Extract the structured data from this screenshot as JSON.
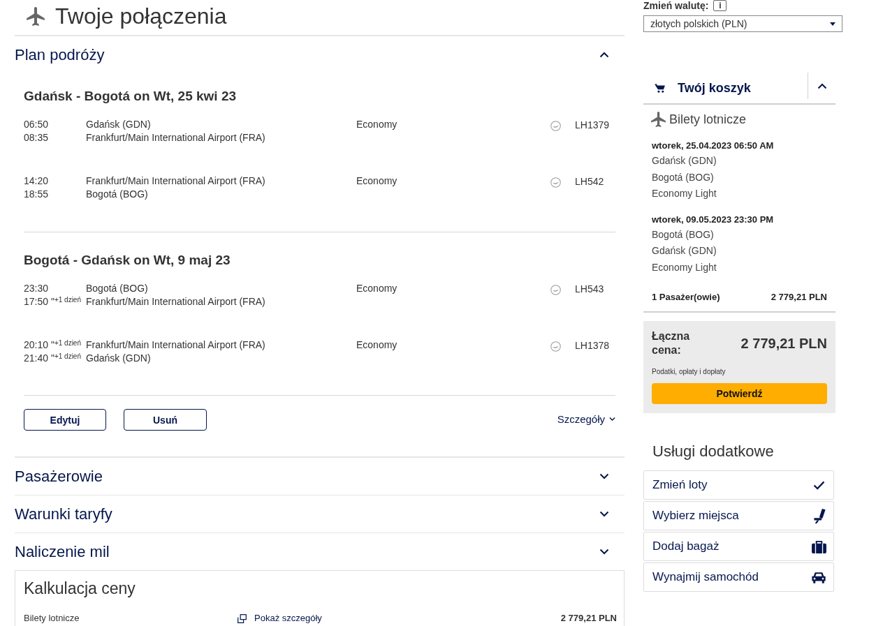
{
  "page_title": "Twoje połączenia",
  "itinerary": {
    "title": "Plan podróży",
    "expanded": true,
    "bounds": [
      {
        "heading": "Gdańsk - Bogotá on Wt, 25 kwi 23",
        "segments": [
          {
            "departure_time": "06:50",
            "arrival_time": "08:35",
            "origin": "Gdańsk (GDN)",
            "destination": "Frankfurt/Main International Airport (FRA)",
            "cabin": "Economy",
            "flight": "LH1379"
          },
          {
            "departure_time": "14:20",
            "arrival_time": "18:55",
            "origin": "Frankfurt/Main International Airport (FRA)",
            "destination": "Bogotá (BOG)",
            "cabin": "Economy",
            "flight": "LH542"
          }
        ]
      },
      {
        "heading": "Bogotá - Gdańsk on Wt, 9 maj 23",
        "segments": [
          {
            "departure_time": "23:30",
            "arrival_time": "17:50 \"$^{+1 dzień}$",
            "origin": "Bogotá (BOG)",
            "destination": "Frankfurt/Main International Airport (FRA)",
            "cabin": "Economy",
            "flight": "LH543"
          },
          {
            "departure_time": "20:10 \"$^{+1 dzień}$",
            "arrival_time": "21:40 \"$^{+1 dzień}$",
            "origin": "Frankfurt/Main International Airport (FRA)",
            "destination": "Gdańsk (GDN)",
            "cabin": "Economy",
            "flight": "LH1378"
          }
        ]
      }
    ],
    "buttons": [
      "Edytuj",
      "Usuń"
    ],
    "details_link": "Szczegóły"
  },
  "sections": [
    {
      "title": "Pasażerowie",
      "expanded": false
    },
    {
      "title": "Warunki taryfy",
      "expanded": false
    },
    {
      "title": "Naliczenie mil",
      "expanded": false
    }
  ],
  "price_calculation": {
    "title": "Kalkulacja ceny",
    "rows": [
      {
        "label": "Bilety lotnicze",
        "link": "Pokaż szczegóły",
        "amount": "2 779,21 PLN"
      }
    ]
  },
  "currency": {
    "label": "Zmień walutę:",
    "info": "i",
    "value": "złotych polskich (PLN)"
  },
  "cart": {
    "title": "Twój koszyk",
    "expanded": true,
    "section": "Bilety lotnicze",
    "flights": [
      {
        "date": "wtorek, 25.04.2023 06:50 AM",
        "lines": [
          "Gdańsk (GDN)",
          "Bogotá (BOG)",
          "Economy Light"
        ]
      },
      {
        "date": "wtorek, 09.05.2023 23:30 PM",
        "lines": [
          "Bogotá (BOG)",
          "Gdańsk (GDN)",
          "Economy Light"
        ]
      }
    ],
    "passengers": "1 Pasażer(owie)",
    "passengers_price": "2 779,21 PLN",
    "total_label": "Łączna cena:",
    "total": "2 779,21 PLN",
    "taxes_note": "Podatki, opłaty i dopłaty",
    "confirm": "Potwierdź"
  },
  "extras": {
    "title": "Usługi dodatkowe",
    "items": [
      {
        "label": "Zmień loty",
        "kind": "check"
      },
      {
        "label": "Wybierz miejsca",
        "kind": "seat"
      },
      {
        "label": "Dodaj bagaż",
        "kind": "baggage"
      },
      {
        "label": "Wynajmij samochód",
        "kind": "car"
      }
    ]
  }
}
